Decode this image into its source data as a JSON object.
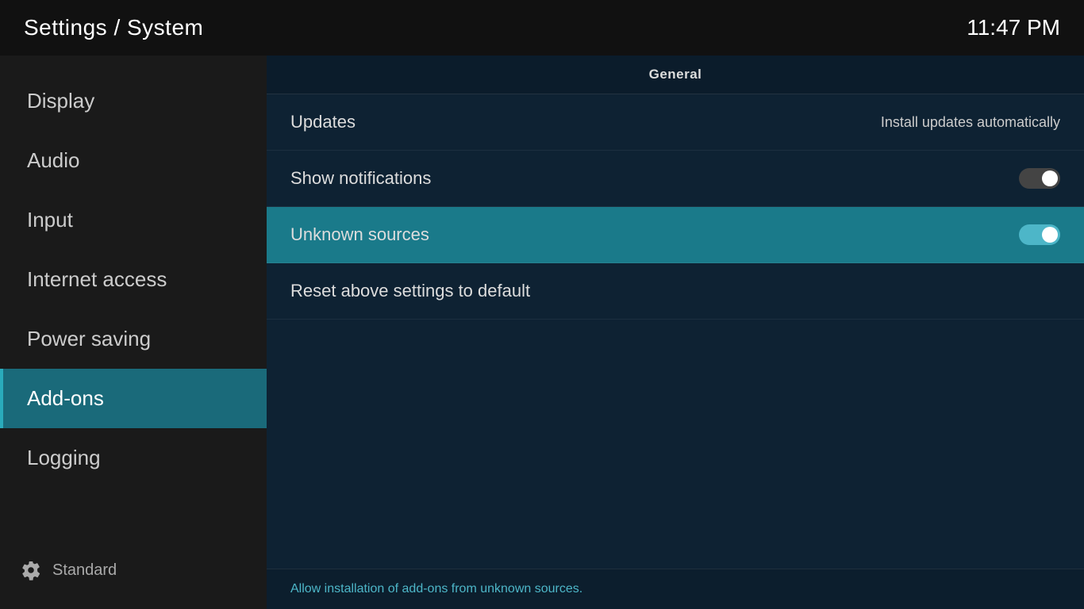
{
  "header": {
    "title": "Settings / System",
    "time": "11:47 PM"
  },
  "sidebar": {
    "items": [
      {
        "id": "display",
        "label": "Display",
        "active": false
      },
      {
        "id": "audio",
        "label": "Audio",
        "active": false
      },
      {
        "id": "input",
        "label": "Input",
        "active": false
      },
      {
        "id": "internet-access",
        "label": "Internet access",
        "active": false
      },
      {
        "id": "power-saving",
        "label": "Power saving",
        "active": false
      },
      {
        "id": "add-ons",
        "label": "Add-ons",
        "active": true
      },
      {
        "id": "logging",
        "label": "Logging",
        "active": false
      }
    ],
    "footer": {
      "label": "Standard"
    }
  },
  "content": {
    "section_label": "General",
    "settings": [
      {
        "id": "updates",
        "label": "Updates",
        "value_text": "Install updates automatically",
        "toggle": null,
        "selected": false
      },
      {
        "id": "show-notifications",
        "label": "Show notifications",
        "value_text": null,
        "toggle": "off",
        "selected": false
      },
      {
        "id": "unknown-sources",
        "label": "Unknown sources",
        "value_text": null,
        "toggle": "on",
        "selected": true
      },
      {
        "id": "reset-settings",
        "label": "Reset above settings to default",
        "value_text": null,
        "toggle": null,
        "selected": false
      }
    ],
    "footer_hint": "Allow installation of add-ons from unknown sources."
  }
}
